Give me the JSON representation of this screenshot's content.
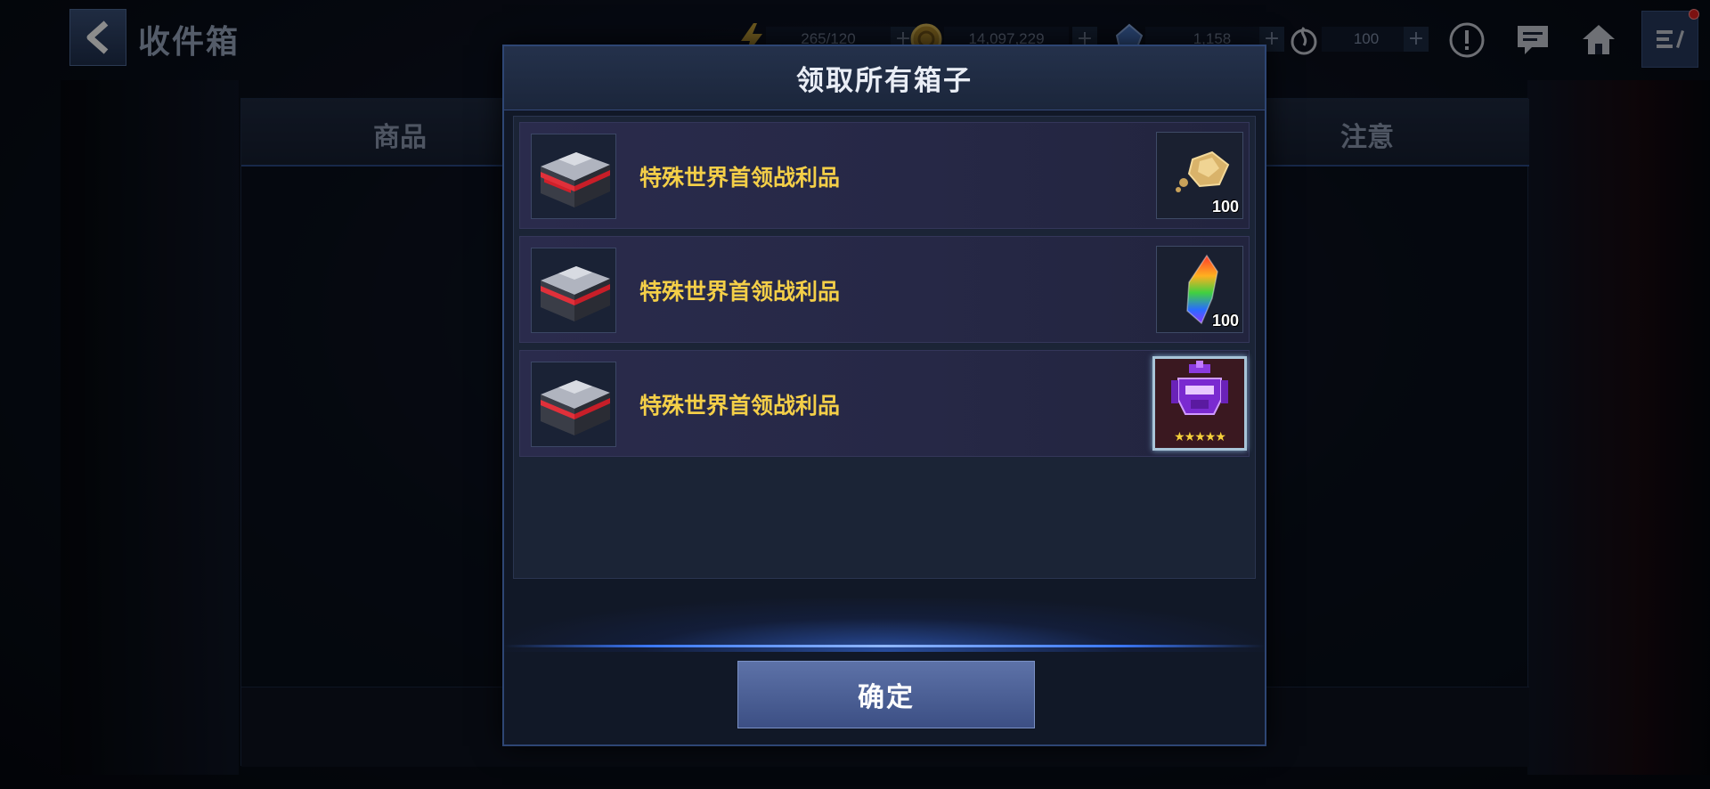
{
  "header": {
    "title": "收件箱",
    "resources": [
      {
        "icon": "energy-icon",
        "value": "265/120"
      },
      {
        "icon": "gold-icon",
        "value": "14,097,229"
      },
      {
        "icon": "crystal-icon",
        "value": "1,158"
      },
      {
        "icon": "stamina-icon",
        "value": "100"
      }
    ]
  },
  "background_table": {
    "columns": [
      "商品",
      "注意"
    ]
  },
  "dialog": {
    "title": "领取所有箱子",
    "items": [
      {
        "label": "特殊世界首领战利品",
        "reward": "gold-ore-icon",
        "quantity": "100"
      },
      {
        "label": "特殊世界首领战利品",
        "reward": "rainbow-crystal-icon",
        "quantity": "100"
      },
      {
        "label": "特殊世界首领战利品",
        "reward": "hero-portrait",
        "stars": "★★★★★"
      }
    ],
    "confirm_label": "确定"
  },
  "colors": {
    "item_label": "#f4cf48",
    "accent_blue": "#3d7bff",
    "confirm_button": "#4f64a0"
  }
}
